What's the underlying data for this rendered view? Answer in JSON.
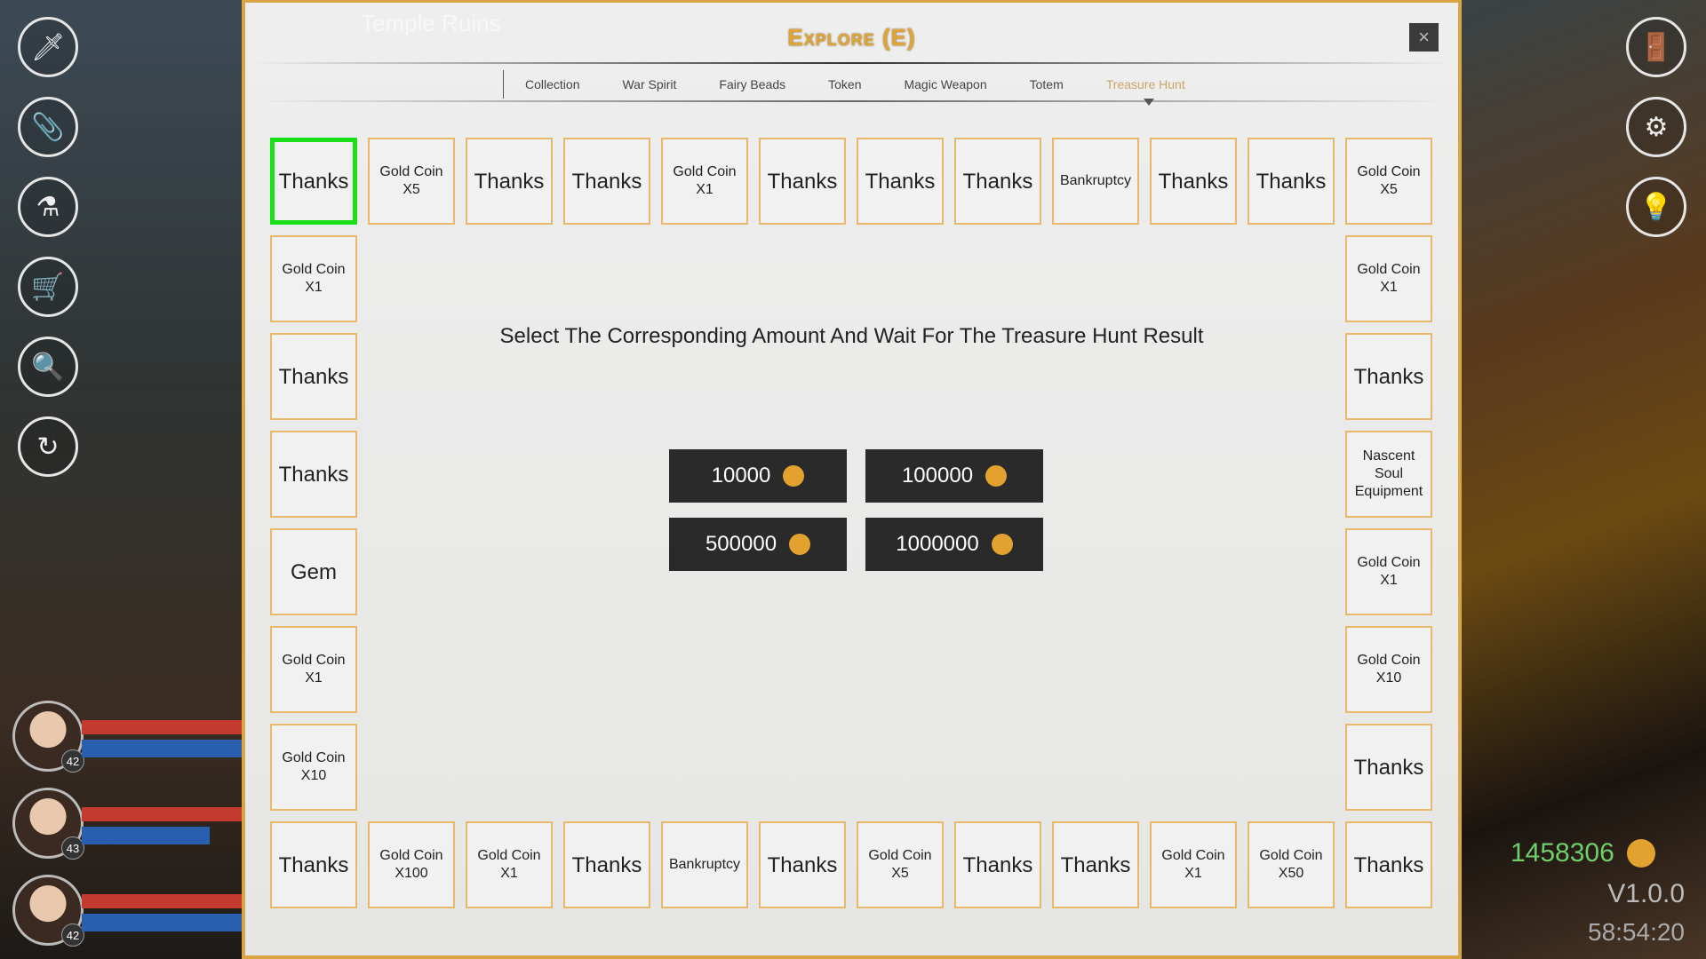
{
  "location": "Temple Ruins",
  "window": {
    "title": "Explore (E)",
    "close_label": "×"
  },
  "tabs": [
    {
      "label": "Collection"
    },
    {
      "label": "War Spirit"
    },
    {
      "label": "Fairy Beads"
    },
    {
      "label": "Token"
    },
    {
      "label": "Magic Weapon"
    },
    {
      "label": "Totem"
    },
    {
      "label": "Treasure Hunt",
      "active": true
    }
  ],
  "board": {
    "top": [
      "Thanks",
      "Gold Coin X5",
      "Thanks",
      "Thanks",
      "Gold Coin X1",
      "Thanks",
      "Thanks",
      "Thanks",
      "Bankruptcy",
      "Thanks",
      "Thanks",
      "Gold Coin X5"
    ],
    "left": [
      "Gold Coin X1",
      "Thanks",
      "Thanks",
      "Gem",
      "Gold Coin X1",
      "Gold Coin X10"
    ],
    "right": [
      "Gold Coin X1",
      "Thanks",
      "Nascent Soul Equipment",
      "Gold Coin X1",
      "Gold Coin X10",
      "Thanks"
    ],
    "bottom": [
      "Thanks",
      "Gold Coin X100",
      "Gold Coin X1",
      "Thanks",
      "Bankruptcy",
      "Thanks",
      "Gold Coin X5",
      "Thanks",
      "Thanks",
      "Gold Coin X1",
      "Gold Coin X50",
      "Thanks"
    ],
    "selected": "top-0"
  },
  "instruction": "Select The Corresponding Amount And Wait For The Treasure Hunt Result",
  "amounts": [
    "10000",
    "100000",
    "500000",
    "1000000"
  ],
  "left_icons": [
    "sword-icon",
    "paperclip-icon",
    "potion-icon",
    "cart-icon",
    "search-icon",
    "refresh-icon"
  ],
  "right_icons": [
    "door-icon",
    "gear-icon",
    "bulb-icon"
  ],
  "party": [
    {
      "level": "42",
      "hp": 1.0,
      "mp": 1.0
    },
    {
      "level": "43",
      "hp": 1.0,
      "mp": 0.8
    },
    {
      "level": "42",
      "hp": 1.0,
      "mp": 1.0
    }
  ],
  "status": {
    "gold": "1458306",
    "version": "V1.0.0",
    "time": "58:54:20"
  },
  "colors": {
    "accent": "#d9a545",
    "selected": "#19e019",
    "gold_text": "#6fd06a",
    "coin": "#e3a12f"
  }
}
